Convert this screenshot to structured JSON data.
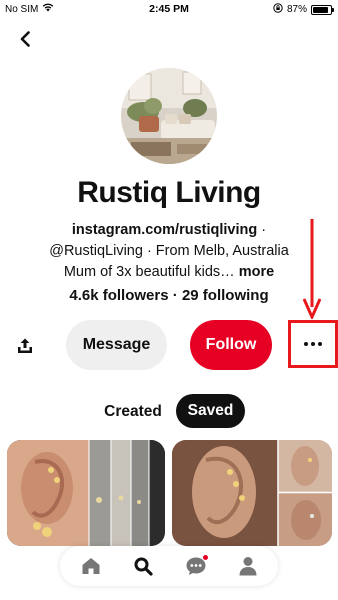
{
  "status_bar": {
    "carrier": "No SIM",
    "time": "2:45 PM",
    "battery_percent": "87%",
    "battery_level": 0.87,
    "icons": [
      "wifi-icon",
      "orientation-lock-icon",
      "battery-icon"
    ]
  },
  "profile": {
    "name": "Rustiq Living",
    "bio_link": "instagram.com/rustiqliving",
    "bio_separator": " ·",
    "bio_line2": "@RustiqLiving · From Melb, Australia",
    "bio_line3": "Mum of 3x beautiful kids…",
    "bio_more": "more",
    "followers": "4.6k followers",
    "stats_separator": " · ",
    "following": "29 following"
  },
  "actions": {
    "message_label": "Message",
    "follow_label": "Follow",
    "icons": [
      "share-icon",
      "more-options-icon"
    ]
  },
  "tabs": [
    {
      "label": "Created",
      "active": false
    },
    {
      "label": "Saved",
      "active": true
    }
  ],
  "bottom_nav": {
    "items": [
      "home-icon",
      "search-icon",
      "messages-icon",
      "profile-icon"
    ]
  },
  "colors": {
    "brand_red": "#e60023",
    "annotation_red": "#e8191c",
    "message_bg": "#efefef",
    "saved_tab_bg": "#111111"
  }
}
